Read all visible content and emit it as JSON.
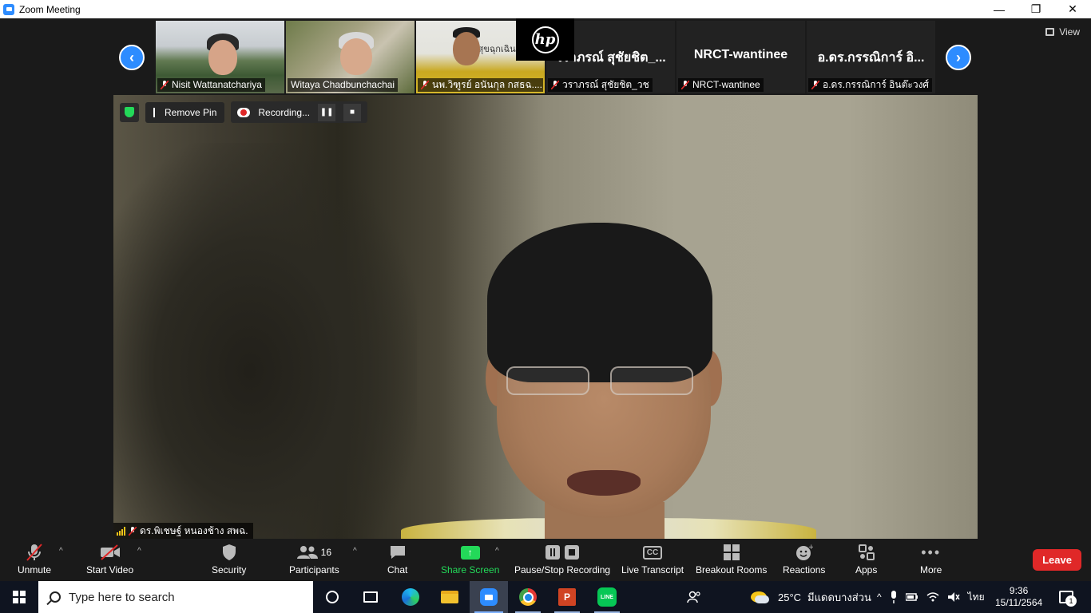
{
  "window": {
    "title": "Zoom Meeting",
    "controls": [
      "—",
      "❐",
      "✕"
    ]
  },
  "meeting": {
    "overlay_logo": "hp",
    "view_label": "View",
    "gallery": [
      {
        "name": "Nisit Wattanatchariya",
        "muted": true
      },
      {
        "name": "Witaya Chadbunchachai",
        "muted": false
      },
      {
        "name": "นพ.วิฑูรย์ อนันกุล กสธฉ....",
        "muted": true
      },
      {
        "name": "วราภรณ์ สุชัยชิต_วช",
        "big_name": "วราภรณ์ สุชัยชิต_...",
        "muted": true
      },
      {
        "name": "NRCT-wantinee",
        "big_name": "NRCT-wantinee",
        "muted": true
      },
      {
        "name": "อ.ดร.กรรณิการ์ อินต๊ะวงศ์",
        "big_name": "อ.ดร.กรรณิการ์ อิ...",
        "muted": true
      }
    ],
    "gallery_background_text": "นสุขฉุกเฉิน",
    "pin_label": "Remove Pin",
    "recording_label": "Recording...",
    "speaker_name": "ดร.พิเชษฐ์ หนองช้าง สพฉ."
  },
  "toolbar": {
    "unmute": "Unmute",
    "start_video": "Start Video",
    "security": "Security",
    "participants": "Participants",
    "participants_count": "16",
    "chat": "Chat",
    "share_screen": "Share Screen",
    "pause_stop_recording": "Pause/Stop Recording",
    "live_transcript": "Live Transcript",
    "cc_icon_text": "CC",
    "breakout_rooms": "Breakout Rooms",
    "reactions": "Reactions",
    "apps": "Apps",
    "more": "More",
    "leave": "Leave",
    "colors": {
      "share_green": "#23d959",
      "leave_red": "#e02828",
      "accent_blue": "#2d8cff"
    }
  },
  "taskbar": {
    "search_placeholder": "Type here to search",
    "ppt_letter": "P",
    "line_label": "LINE",
    "weather_temp": "25°C",
    "weather_text": "มีแดดบางส่วน",
    "language": "ไทย",
    "time": "9:36",
    "date": "15/11/2564",
    "notification_count": "1"
  }
}
